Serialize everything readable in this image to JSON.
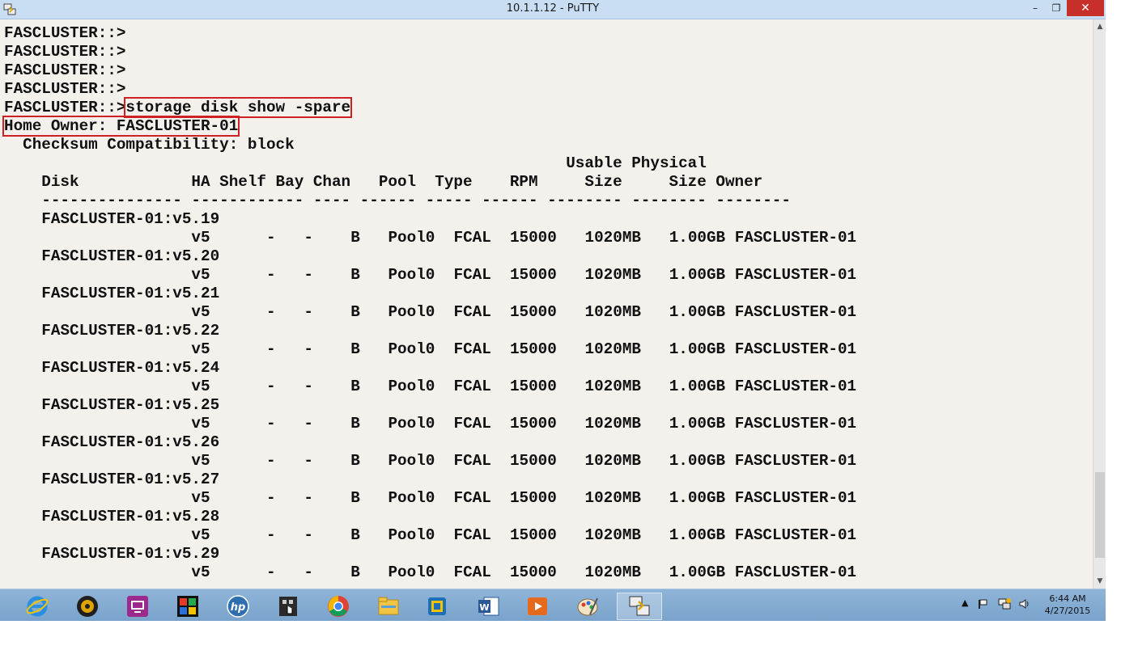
{
  "window": {
    "title": "10.1.1.12 - PuTTY",
    "minimize_glyph": "–",
    "maximize_glyph": "❐",
    "close_glyph": "✕"
  },
  "terminal": {
    "prompt": "FASCLUSTER::>",
    "command": "storage disk show -spare",
    "home_owner_label": "Home Owner: FASCLUSTER-01",
    "checksum_line": "  Checksum Compatibility: block",
    "header_line1": "                                                            Usable Physical",
    "header_line2": "    Disk            HA Shelf Bay Chan   Pool  Type    RPM     Size     Size Owner",
    "divider_line": "    --------------- ------------ ---- ------ ----- ------ -------- -------- --------",
    "rows": [
      {
        "disk": "FASCLUSTER-01:v5.19",
        "ha": "v5",
        "shelf": "-",
        "bay": "-",
        "chan": "B",
        "pool": "Pool0",
        "type": "FCAL",
        "rpm": "15000",
        "usable": "1020MB",
        "physical": "1.00GB",
        "owner": "FASCLUSTER-01"
      },
      {
        "disk": "FASCLUSTER-01:v5.20",
        "ha": "v5",
        "shelf": "-",
        "bay": "-",
        "chan": "B",
        "pool": "Pool0",
        "type": "FCAL",
        "rpm": "15000",
        "usable": "1020MB",
        "physical": "1.00GB",
        "owner": "FASCLUSTER-01"
      },
      {
        "disk": "FASCLUSTER-01:v5.21",
        "ha": "v5",
        "shelf": "-",
        "bay": "-",
        "chan": "B",
        "pool": "Pool0",
        "type": "FCAL",
        "rpm": "15000",
        "usable": "1020MB",
        "physical": "1.00GB",
        "owner": "FASCLUSTER-01"
      },
      {
        "disk": "FASCLUSTER-01:v5.22",
        "ha": "v5",
        "shelf": "-",
        "bay": "-",
        "chan": "B",
        "pool": "Pool0",
        "type": "FCAL",
        "rpm": "15000",
        "usable": "1020MB",
        "physical": "1.00GB",
        "owner": "FASCLUSTER-01"
      },
      {
        "disk": "FASCLUSTER-01:v5.24",
        "ha": "v5",
        "shelf": "-",
        "bay": "-",
        "chan": "B",
        "pool": "Pool0",
        "type": "FCAL",
        "rpm": "15000",
        "usable": "1020MB",
        "physical": "1.00GB",
        "owner": "FASCLUSTER-01"
      },
      {
        "disk": "FASCLUSTER-01:v5.25",
        "ha": "v5",
        "shelf": "-",
        "bay": "-",
        "chan": "B",
        "pool": "Pool0",
        "type": "FCAL",
        "rpm": "15000",
        "usable": "1020MB",
        "physical": "1.00GB",
        "owner": "FASCLUSTER-01"
      },
      {
        "disk": "FASCLUSTER-01:v5.26",
        "ha": "v5",
        "shelf": "-",
        "bay": "-",
        "chan": "B",
        "pool": "Pool0",
        "type": "FCAL",
        "rpm": "15000",
        "usable": "1020MB",
        "physical": "1.00GB",
        "owner": "FASCLUSTER-01"
      },
      {
        "disk": "FASCLUSTER-01:v5.27",
        "ha": "v5",
        "shelf": "-",
        "bay": "-",
        "chan": "B",
        "pool": "Pool0",
        "type": "FCAL",
        "rpm": "15000",
        "usable": "1020MB",
        "physical": "1.00GB",
        "owner": "FASCLUSTER-01"
      },
      {
        "disk": "FASCLUSTER-01:v5.28",
        "ha": "v5",
        "shelf": "-",
        "bay": "-",
        "chan": "B",
        "pool": "Pool0",
        "type": "FCAL",
        "rpm": "15000",
        "usable": "1020MB",
        "physical": "1.00GB",
        "owner": "FASCLUSTER-01"
      },
      {
        "disk": "FASCLUSTER-01:v5.29",
        "ha": "v5",
        "shelf": "-",
        "bay": "-",
        "chan": "B",
        "pool": "Pool0",
        "type": "FCAL",
        "rpm": "15000",
        "usable": "1020MB",
        "physical": "1.00GB",
        "owner": "FASCLUSTER-01"
      }
    ],
    "highlight_color": "#d02024"
  },
  "taskbar": {
    "apps": [
      {
        "name": "internet-explorer-icon"
      },
      {
        "name": "media-player-disc-icon"
      },
      {
        "name": "remote-desktop-icon"
      },
      {
        "name": "color-grid-app-icon"
      },
      {
        "name": "hp-icon"
      },
      {
        "name": "touch-app-icon"
      },
      {
        "name": "chrome-icon"
      },
      {
        "name": "file-explorer-icon"
      },
      {
        "name": "virtualbox-icon"
      },
      {
        "name": "word-icon"
      },
      {
        "name": "media-center-icon"
      },
      {
        "name": "paint-icon"
      },
      {
        "name": "putty-icon"
      }
    ],
    "clock": {
      "time": "6:44 AM",
      "date": "4/27/2015"
    },
    "tray_expand_glyph": "▲"
  }
}
